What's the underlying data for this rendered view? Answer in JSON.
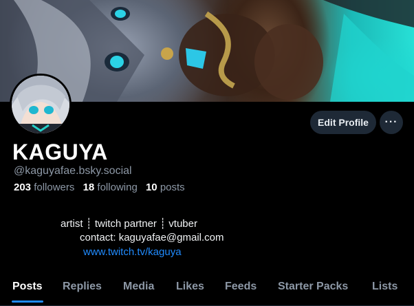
{
  "profile": {
    "display_name": "KAGUYA",
    "handle": "@kaguyafae.bsky.social",
    "followers_count": "203",
    "followers_label": "followers",
    "following_count": "18",
    "following_label": "following",
    "posts_count": "10",
    "posts_label": "posts"
  },
  "actions": {
    "edit_profile": "Edit Profile",
    "more": "···"
  },
  "bio": {
    "line1": "artist ┊ twitch partner ┊ vtuber",
    "line2": "contact: kaguyafae@gmail.com",
    "link": "www.twitch.tv/kaguya"
  },
  "tabs": [
    {
      "label": "Posts",
      "active": true
    },
    {
      "label": "Replies",
      "active": false
    },
    {
      "label": "Media",
      "active": false
    },
    {
      "label": "Likes",
      "active": false
    },
    {
      "label": "Feeds",
      "active": false
    },
    {
      "label": "Starter Packs",
      "active": false
    },
    {
      "label": "Lists",
      "active": false
    }
  ],
  "colors": {
    "background": "#000000",
    "accent": "#208bfe",
    "muted_text": "#8d98a6",
    "button_bg": "#1e2936"
  }
}
